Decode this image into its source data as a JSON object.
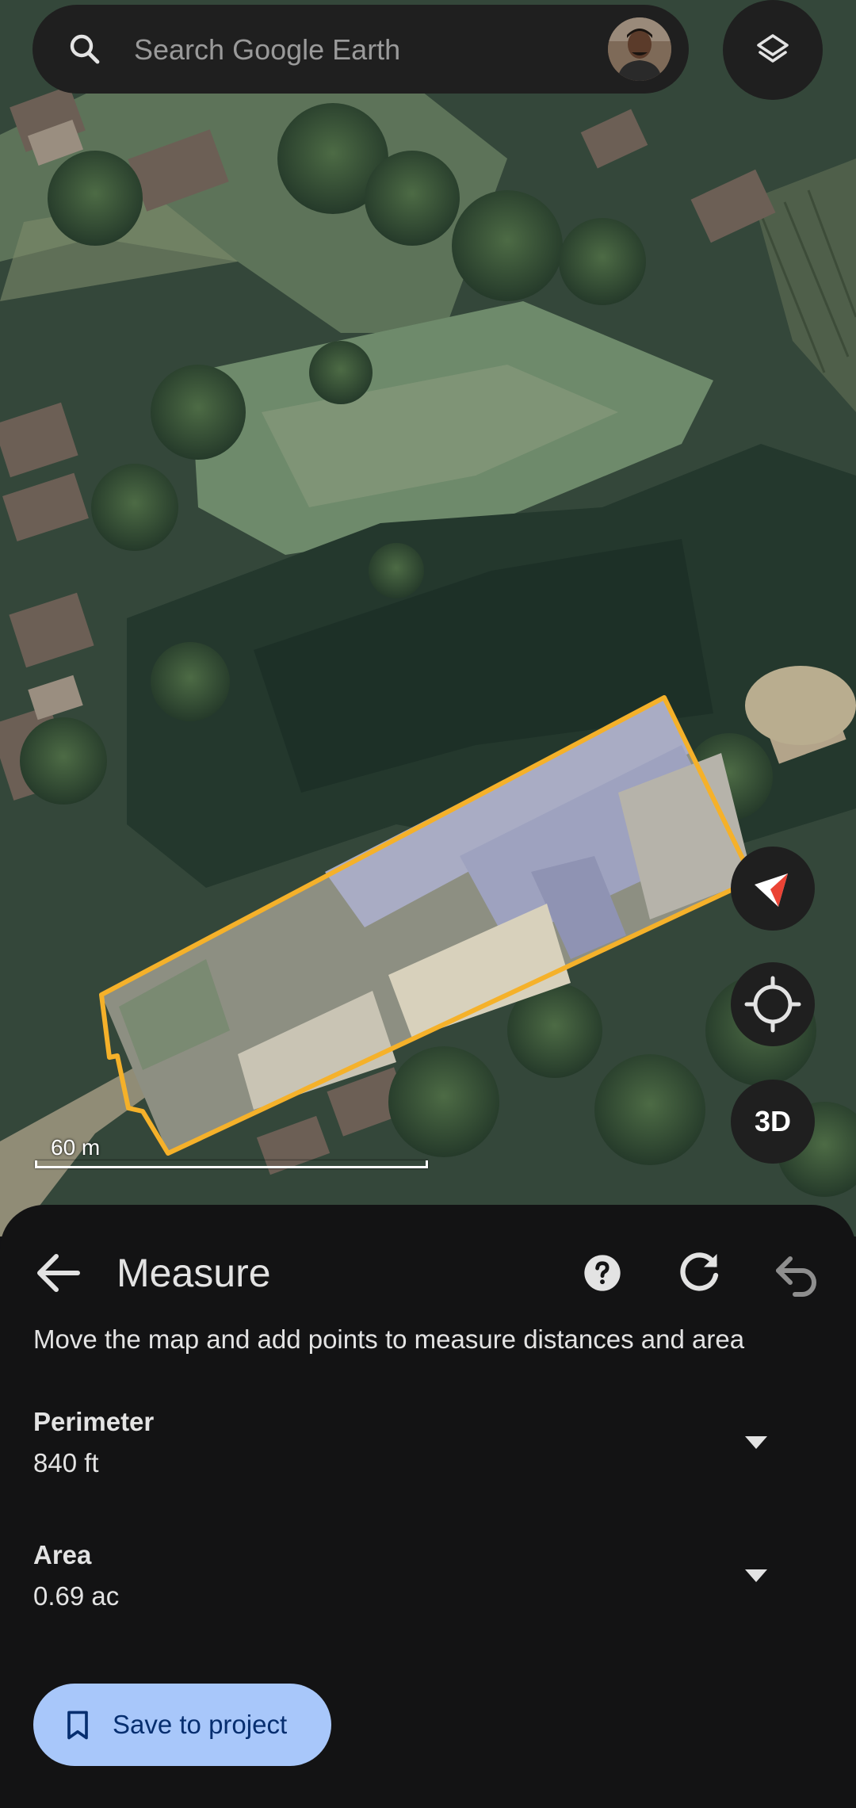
{
  "search": {
    "placeholder": "Search Google Earth"
  },
  "map": {
    "scale_label": "60 m",
    "button_3d": "3D",
    "outline_color": "#f5b12a"
  },
  "sheet": {
    "title": "Measure",
    "instructions": "Move the map and add points to measure distances and area",
    "perimeter_label": "Perimeter",
    "perimeter_value": "840 ft",
    "area_label": "Area",
    "area_value": "0.69 ac",
    "save_label": "Save to project"
  },
  "icons": {
    "search": "search-icon",
    "layers": "layers-icon",
    "compass": "compass-icon",
    "locate": "my-location-icon",
    "back": "arrow-back-icon",
    "help": "help-icon",
    "reset": "refresh-icon",
    "undo": "undo-icon",
    "dropdown": "arrow-drop-down-icon",
    "save": "bookmark-icon"
  },
  "colors": {
    "sheet_bg": "#131314",
    "chip_bg": "#1f1f1f",
    "save_button_bg": "#a8c7fa",
    "save_button_text": "#062e6f"
  }
}
